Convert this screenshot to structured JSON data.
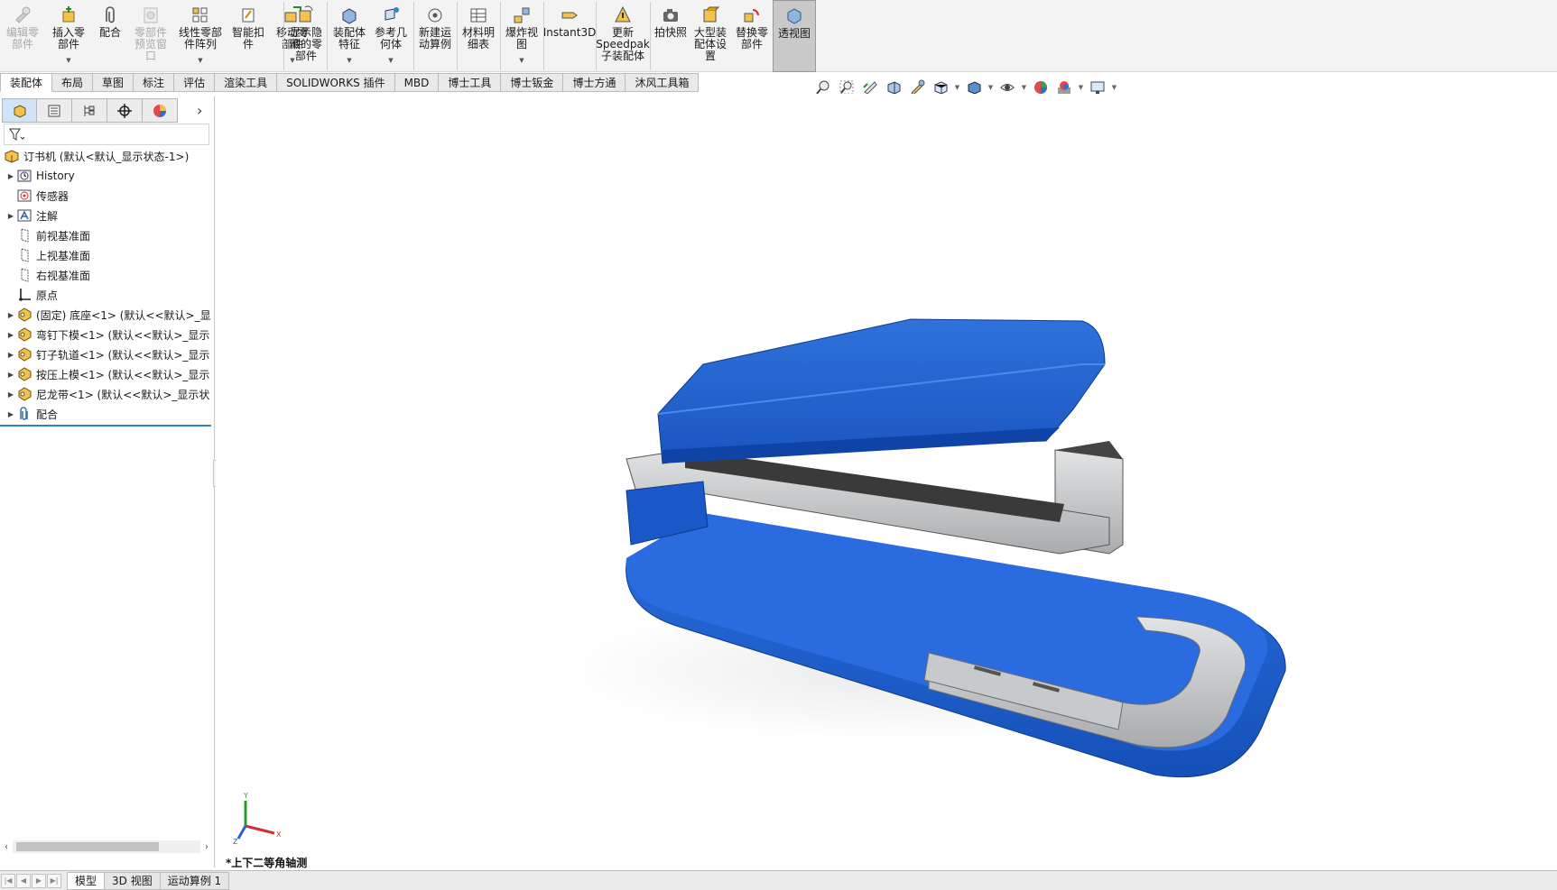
{
  "ribbon": {
    "edit_component": "编辑零\n部件",
    "insert_component": "插入零\n部件",
    "mate": "配合",
    "component_preview": "零部件\n预览窗\n口",
    "linear_pattern": "线性零部\n件阵列",
    "smart_fasteners": "智能扣\n件",
    "move_component": "移动零\n部件",
    "show_hidden": "显示隐\n藏的零\n部件",
    "assembly_features": "装配体\n特征",
    "reference_geometry": "参考几\n何体",
    "new_motion_study": "新建运\n动算例",
    "bom": "材料明\n细表",
    "exploded_view": "爆炸视\n图",
    "instant3d": "Instant3D",
    "update_speedpak": "更新\nSpeedpak\n子装配体",
    "snapshot": "拍快照",
    "large_assembly": "大型装\n配体设\n置",
    "replace_components": "替换零\n部件",
    "transparent_view": "透视图"
  },
  "tabs": [
    "装配体",
    "布局",
    "草图",
    "标注",
    "评估",
    "渲染工具",
    "SOLIDWORKS 插件",
    "MBD",
    "博士工具",
    "博士钣金",
    "博士方通",
    "沐风工具箱"
  ],
  "tree": {
    "root": "订书机  (默认<默认_显示状态-1>)",
    "history": "History",
    "sensors": "传感器",
    "annotations": "注解",
    "front_plane": "前视基准面",
    "top_plane": "上视基准面",
    "right_plane": "右视基准面",
    "origin": "原点",
    "comp1": "(固定) 底座<1> (默认<<默认>_显",
    "comp2": "弯钉下模<1> (默认<<默认>_显示",
    "comp3": "钉子轨道<1> (默认<<默认>_显示",
    "comp4": "按压上模<1> (默认<<默认>_显示",
    "comp5": "尼龙带<1> (默认<<默认>_显示状",
    "mates": "配合"
  },
  "viewport": {
    "view_name": "*上下二等角轴测",
    "triad": {
      "x": "X",
      "y": "Y",
      "z": "Z"
    }
  },
  "bottom_tabs": [
    "模型",
    "3D 视图",
    "运动算例 1"
  ],
  "colors": {
    "accent_blue": "#2f84c9",
    "stapler_blue": "#1f5fd0",
    "metal": "#cfd1d3"
  }
}
